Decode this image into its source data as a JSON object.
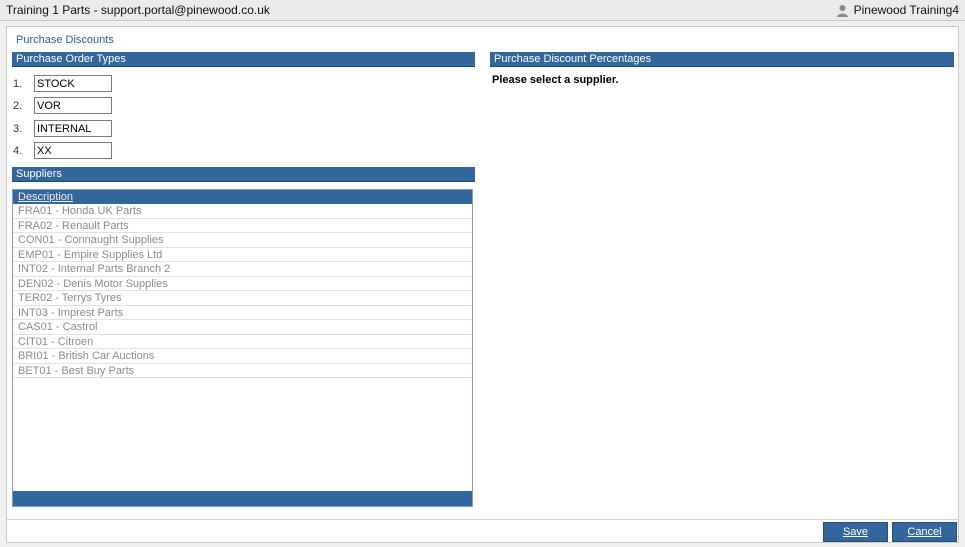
{
  "titlebar": {
    "title": "Training 1 Parts - support.portal@pinewood.co.uk",
    "user_name": "Pinewood Training4"
  },
  "panel": {
    "title": "Purchase Discounts"
  },
  "purchase_order_types": {
    "header": "Purchase Order Types",
    "items": [
      {
        "num": "1.",
        "value": "STOCK"
      },
      {
        "num": "2.",
        "value": "VOR"
      },
      {
        "num": "3.",
        "value": "INTERNAL"
      },
      {
        "num": "4.",
        "value": "XX"
      }
    ]
  },
  "suppliers": {
    "header": "Suppliers",
    "column_header": "Description",
    "rows": [
      "FRA01 - Honda UK Parts",
      "FRA02 - Renault Parts",
      "CON01 - Connaught Supplies",
      "EMP01 - Empire Supplies Ltd",
      "INT02 - Internal Parts Branch 2",
      "DEN02 - Denis Motor Supplies",
      "TER02 - Terrys Tyres",
      "INT03 - Imprest Parts",
      "CAS01 - Castrol",
      "CIT01 - Citroen",
      "BRI01 - British Car Auctions",
      "BET01 - Best Buy Parts"
    ]
  },
  "purchase_discount_percentages": {
    "header": "Purchase Discount Percentages",
    "message": "Please select a supplier."
  },
  "actions": {
    "save_label": "Save",
    "cancel_label": "Cancel"
  },
  "colors": {
    "header_blue": "#33669a",
    "title_blue": "#2b5f8e"
  },
  "icons": {
    "user": "user-icon"
  }
}
